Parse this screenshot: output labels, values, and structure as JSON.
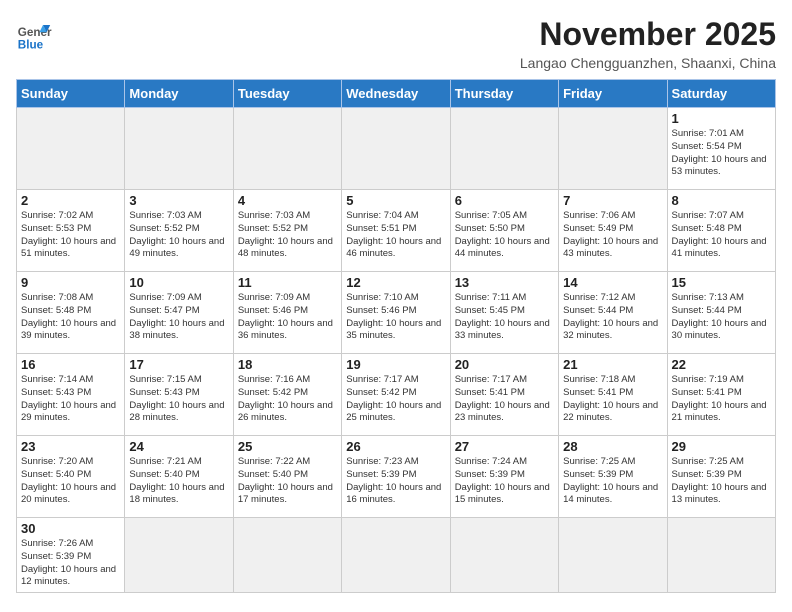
{
  "header": {
    "logo_general": "General",
    "logo_blue": "Blue",
    "month_year": "November 2025",
    "location": "Langao Chengguanzhen, Shaanxi, China"
  },
  "weekdays": [
    "Sunday",
    "Monday",
    "Tuesday",
    "Wednesday",
    "Thursday",
    "Friday",
    "Saturday"
  ],
  "weeks": [
    [
      {
        "day": null,
        "info": null
      },
      {
        "day": null,
        "info": null
      },
      {
        "day": null,
        "info": null
      },
      {
        "day": null,
        "info": null
      },
      {
        "day": null,
        "info": null
      },
      {
        "day": null,
        "info": null
      },
      {
        "day": "1",
        "info": "Sunrise: 7:01 AM\nSunset: 5:54 PM\nDaylight: 10 hours and 53 minutes."
      }
    ],
    [
      {
        "day": "2",
        "info": "Sunrise: 7:02 AM\nSunset: 5:53 PM\nDaylight: 10 hours and 51 minutes."
      },
      {
        "day": "3",
        "info": "Sunrise: 7:03 AM\nSunset: 5:52 PM\nDaylight: 10 hours and 49 minutes."
      },
      {
        "day": "4",
        "info": "Sunrise: 7:03 AM\nSunset: 5:52 PM\nDaylight: 10 hours and 48 minutes."
      },
      {
        "day": "5",
        "info": "Sunrise: 7:04 AM\nSunset: 5:51 PM\nDaylight: 10 hours and 46 minutes."
      },
      {
        "day": "6",
        "info": "Sunrise: 7:05 AM\nSunset: 5:50 PM\nDaylight: 10 hours and 44 minutes."
      },
      {
        "day": "7",
        "info": "Sunrise: 7:06 AM\nSunset: 5:49 PM\nDaylight: 10 hours and 43 minutes."
      },
      {
        "day": "8",
        "info": "Sunrise: 7:07 AM\nSunset: 5:48 PM\nDaylight: 10 hours and 41 minutes."
      }
    ],
    [
      {
        "day": "9",
        "info": "Sunrise: 7:08 AM\nSunset: 5:48 PM\nDaylight: 10 hours and 39 minutes."
      },
      {
        "day": "10",
        "info": "Sunrise: 7:09 AM\nSunset: 5:47 PM\nDaylight: 10 hours and 38 minutes."
      },
      {
        "day": "11",
        "info": "Sunrise: 7:09 AM\nSunset: 5:46 PM\nDaylight: 10 hours and 36 minutes."
      },
      {
        "day": "12",
        "info": "Sunrise: 7:10 AM\nSunset: 5:46 PM\nDaylight: 10 hours and 35 minutes."
      },
      {
        "day": "13",
        "info": "Sunrise: 7:11 AM\nSunset: 5:45 PM\nDaylight: 10 hours and 33 minutes."
      },
      {
        "day": "14",
        "info": "Sunrise: 7:12 AM\nSunset: 5:44 PM\nDaylight: 10 hours and 32 minutes."
      },
      {
        "day": "15",
        "info": "Sunrise: 7:13 AM\nSunset: 5:44 PM\nDaylight: 10 hours and 30 minutes."
      }
    ],
    [
      {
        "day": "16",
        "info": "Sunrise: 7:14 AM\nSunset: 5:43 PM\nDaylight: 10 hours and 29 minutes."
      },
      {
        "day": "17",
        "info": "Sunrise: 7:15 AM\nSunset: 5:43 PM\nDaylight: 10 hours and 28 minutes."
      },
      {
        "day": "18",
        "info": "Sunrise: 7:16 AM\nSunset: 5:42 PM\nDaylight: 10 hours and 26 minutes."
      },
      {
        "day": "19",
        "info": "Sunrise: 7:17 AM\nSunset: 5:42 PM\nDaylight: 10 hours and 25 minutes."
      },
      {
        "day": "20",
        "info": "Sunrise: 7:17 AM\nSunset: 5:41 PM\nDaylight: 10 hours and 23 minutes."
      },
      {
        "day": "21",
        "info": "Sunrise: 7:18 AM\nSunset: 5:41 PM\nDaylight: 10 hours and 22 minutes."
      },
      {
        "day": "22",
        "info": "Sunrise: 7:19 AM\nSunset: 5:41 PM\nDaylight: 10 hours and 21 minutes."
      }
    ],
    [
      {
        "day": "23",
        "info": "Sunrise: 7:20 AM\nSunset: 5:40 PM\nDaylight: 10 hours and 20 minutes."
      },
      {
        "day": "24",
        "info": "Sunrise: 7:21 AM\nSunset: 5:40 PM\nDaylight: 10 hours and 18 minutes."
      },
      {
        "day": "25",
        "info": "Sunrise: 7:22 AM\nSunset: 5:40 PM\nDaylight: 10 hours and 17 minutes."
      },
      {
        "day": "26",
        "info": "Sunrise: 7:23 AM\nSunset: 5:39 PM\nDaylight: 10 hours and 16 minutes."
      },
      {
        "day": "27",
        "info": "Sunrise: 7:24 AM\nSunset: 5:39 PM\nDaylight: 10 hours and 15 minutes."
      },
      {
        "day": "28",
        "info": "Sunrise: 7:25 AM\nSunset: 5:39 PM\nDaylight: 10 hours and 14 minutes."
      },
      {
        "day": "29",
        "info": "Sunrise: 7:25 AM\nSunset: 5:39 PM\nDaylight: 10 hours and 13 minutes."
      }
    ],
    [
      {
        "day": "30",
        "info": "Sunrise: 7:26 AM\nSunset: 5:39 PM\nDaylight: 10 hours and 12 minutes."
      },
      {
        "day": null,
        "info": null
      },
      {
        "day": null,
        "info": null
      },
      {
        "day": null,
        "info": null
      },
      {
        "day": null,
        "info": null
      },
      {
        "day": null,
        "info": null
      },
      {
        "day": null,
        "info": null
      }
    ]
  ]
}
